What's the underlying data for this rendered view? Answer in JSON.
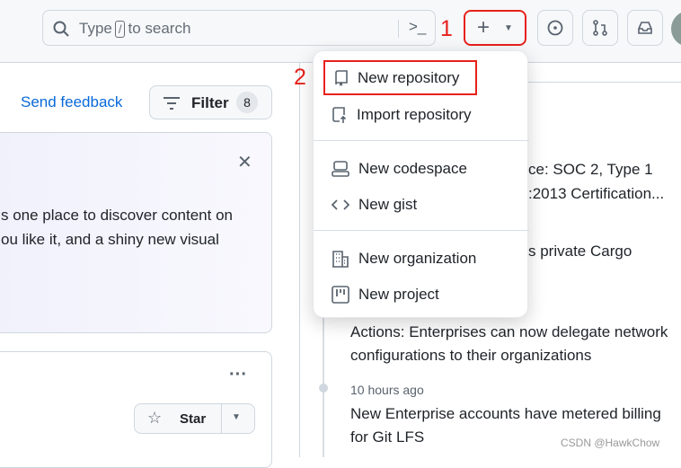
{
  "header": {
    "search_prefix": "Type",
    "search_key": "/",
    "search_suffix": "to search",
    "annotation_1": "1",
    "annotation_2": "2"
  },
  "left": {
    "send_feedback": "Send feedback",
    "filter_label": "Filter",
    "filter_count": "8",
    "card_line1": "s one place to discover content on",
    "card_line2": "ou like it, and a shiny new visual",
    "star_label": "Star",
    "more": "···"
  },
  "menu": {
    "items": [
      {
        "label": "New repository"
      },
      {
        "label": "Import repository"
      },
      {
        "label": "New codespace"
      },
      {
        "label": "New gist"
      },
      {
        "label": "New organization"
      },
      {
        "label": "New project"
      }
    ]
  },
  "feed": {
    "partial1": "ce: SOC 2, Type 1",
    "partial2": ":2013 Certification...",
    "partial3": "s private Cargo",
    "item1": "Actions: Enterprises can now delegate network configurations to their organizations",
    "time2": "10 hours ago",
    "item2": "New Enterprise accounts have metered billing for Git LFS"
  },
  "watermark": "CSDN @HawkChow"
}
